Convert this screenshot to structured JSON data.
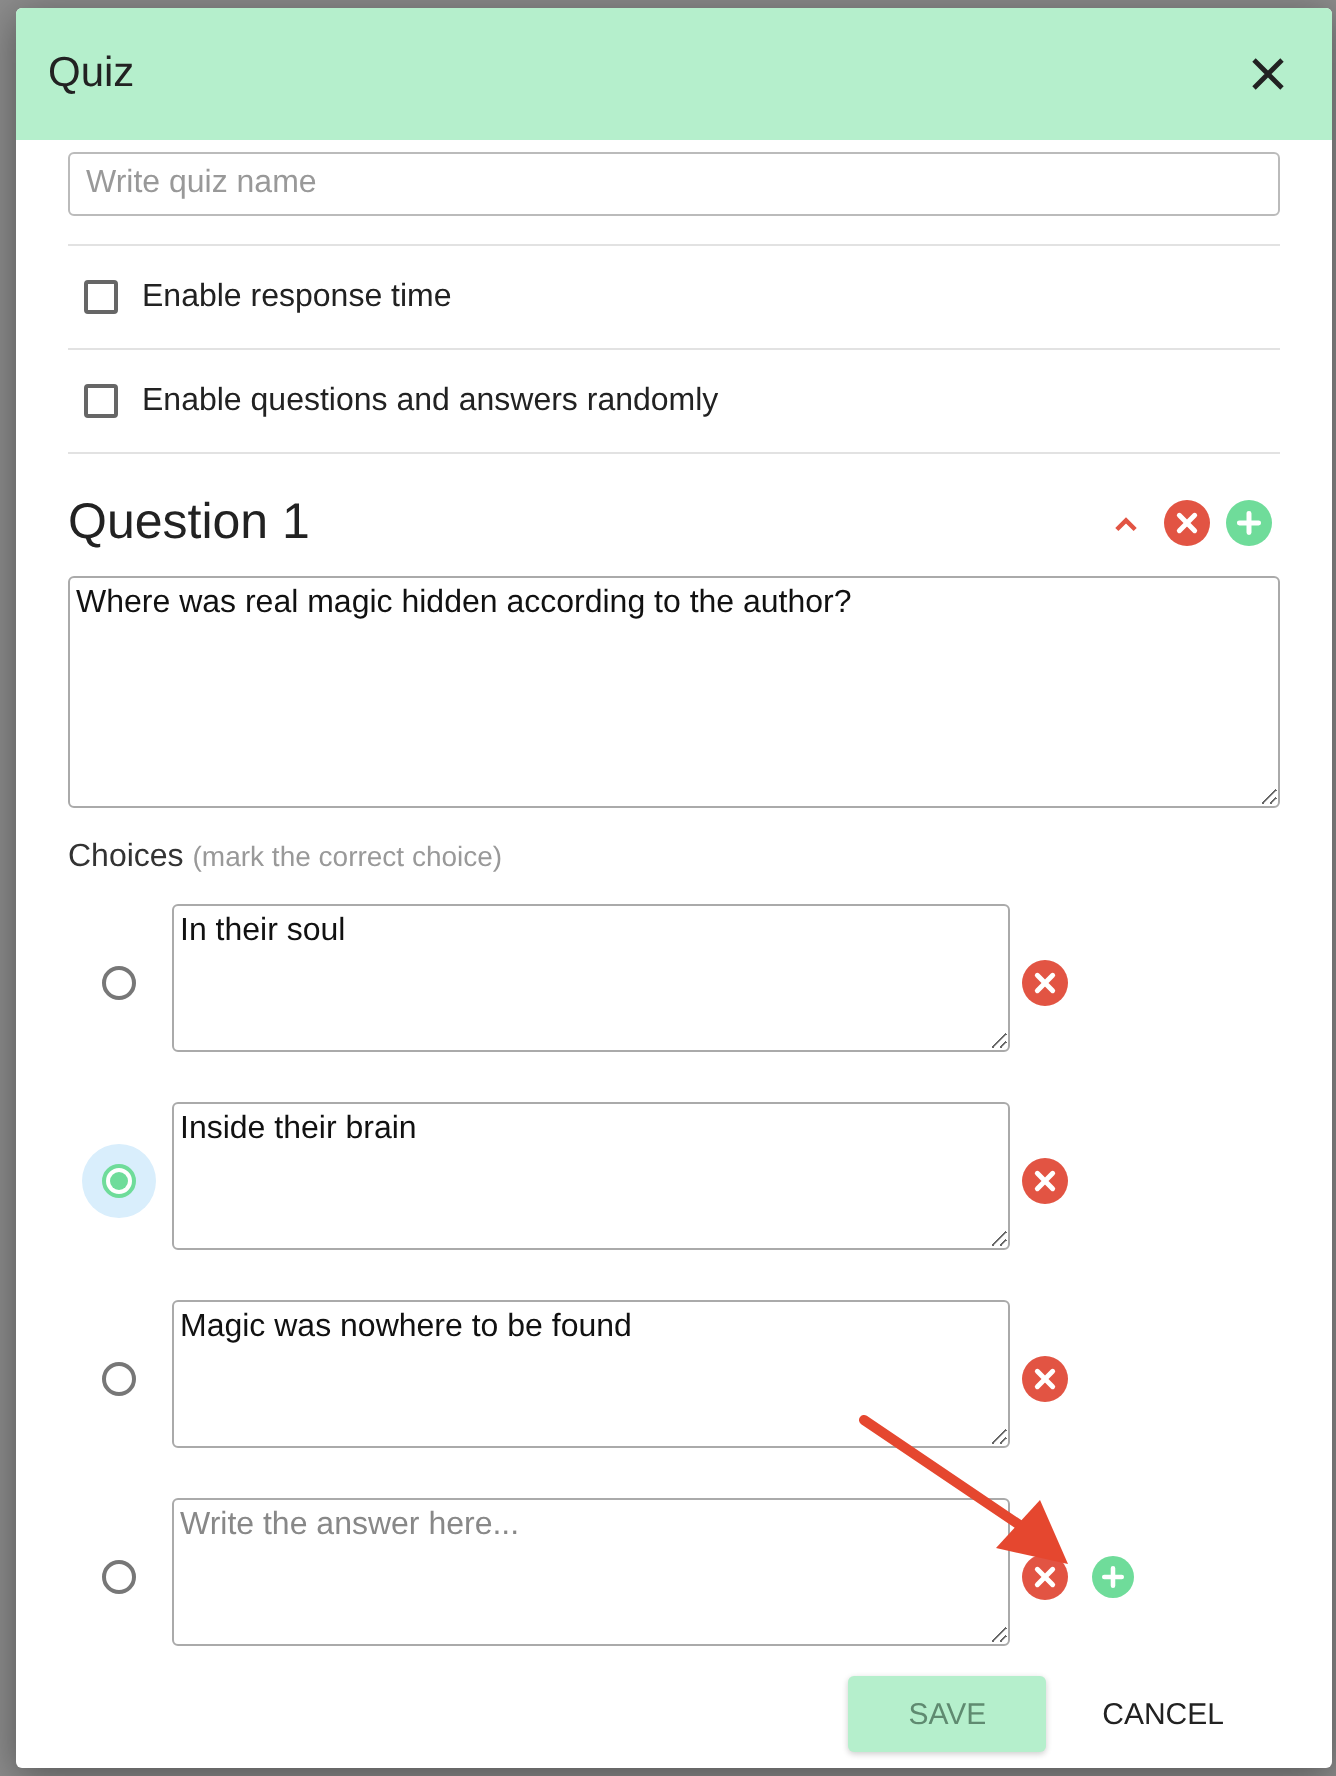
{
  "dialog": {
    "title": "Quiz"
  },
  "quiz_name": {
    "placeholder": "Write quiz name"
  },
  "options": [
    {
      "label": "Enable response time",
      "checked": false
    },
    {
      "label": "Enable questions and answers randomly",
      "checked": false
    }
  ],
  "question": {
    "title": "Question 1",
    "expanded": true,
    "text": "Where was real magic hidden according to the author?"
  },
  "choices": {
    "label": "Choices",
    "hint": "(mark the correct choice)",
    "items": [
      {
        "kind": "answer",
        "value": "In their soul",
        "selected": false
      },
      {
        "kind": "answer",
        "value": "Inside their brain",
        "selected": true
      },
      {
        "kind": "answer",
        "value": "Magic was nowhere to be found",
        "selected": false
      },
      {
        "kind": "new",
        "placeholder": "Write the answer here...",
        "selected": false
      }
    ]
  },
  "buttons": [
    {
      "kind": "primary",
      "label": "SAVE",
      "disabled": true
    },
    {
      "kind": "text",
      "label": "CANCEL",
      "disabled": false
    }
  ]
}
